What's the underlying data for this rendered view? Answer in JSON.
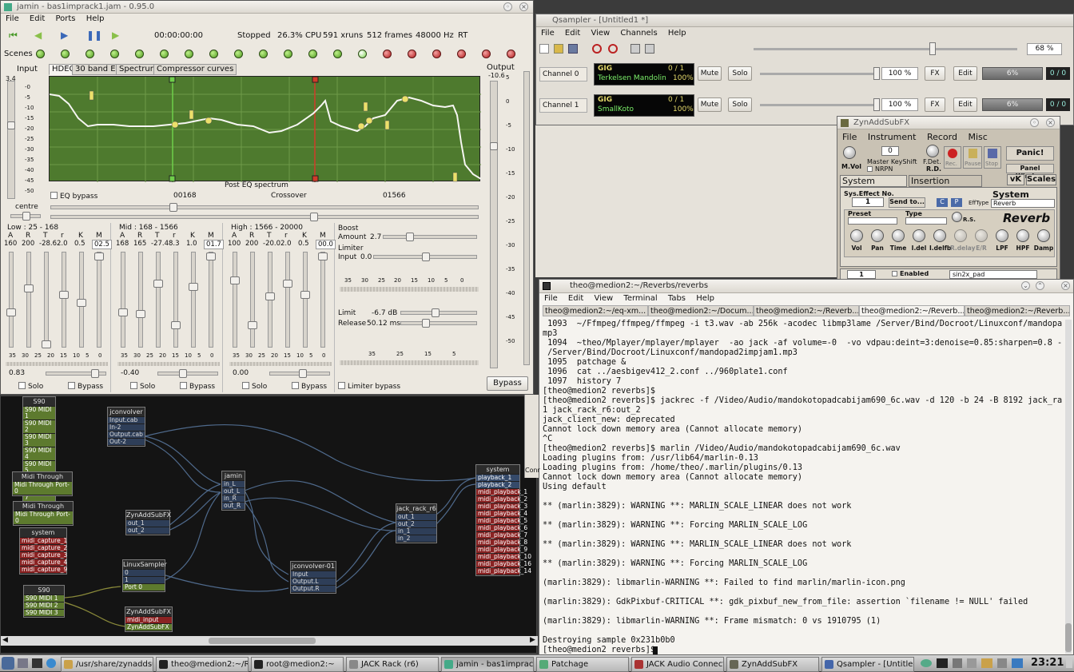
{
  "jamin": {
    "title": "jamin - bas1imprack1.jam - 0.95.0",
    "menu": [
      "File",
      "Edit",
      "Ports",
      "Help"
    ],
    "transport": {
      "time": "00:00:00:00",
      "status": "Stopped",
      "cpu": "26.3% CPU",
      "xruns": "591 xruns",
      "frames": "512 frames",
      "rate": "48000 Hz",
      "rt": "RT"
    },
    "scenes_label": "Scenes",
    "input_label": "Input",
    "input_value": "3.4",
    "input_ticks": [
      "-0",
      "-5",
      "-10",
      "-15",
      "-20",
      "-25",
      "-30",
      "-35",
      "-40",
      "-45",
      "-50"
    ],
    "output_label": "Output",
    "output_value": "-10.6",
    "output_ticks": [
      "5",
      "0",
      "-5",
      "-10",
      "-15",
      "-20",
      "-25",
      "-30",
      "-35",
      "-40",
      "-45",
      "-50"
    ],
    "centre_label": "centre",
    "tabs": [
      "HDEQ",
      "30 band EQ",
      "Spectrum",
      "Compressor curves"
    ],
    "eq_caption": "Post EQ spectrum",
    "eq_bypass": "EQ bypass",
    "xover_low": "00168",
    "crossover": "Crossover",
    "xover_high": "01566",
    "bands": [
      {
        "title": "Low : 25 - 168",
        "params": [
          "A",
          "R",
          "T",
          "r",
          "K",
          "M"
        ],
        "values": [
          "160",
          "200",
          "-28.6",
          "2.0",
          "0.5",
          "02.5"
        ],
        "gain": "0.83",
        "solo": "Solo",
        "bypass": "Bypass"
      },
      {
        "title": "Mid : 168 - 1566",
        "params": [
          "A",
          "R",
          "T",
          "r",
          "K",
          "M"
        ],
        "values": [
          "168",
          "165",
          "-27.4",
          "8.3",
          "1.0",
          "01.7"
        ],
        "gain": "-0.40",
        "solo": "Solo",
        "bypass": "Bypass"
      },
      {
        "title": "High : 1566 - 20000",
        "params": [
          "A",
          "R",
          "T",
          "r",
          "K",
          "M"
        ],
        "values": [
          "100",
          "200",
          "-20.0",
          "2.0",
          "0.5",
          "00.0"
        ],
        "gain": "0.00",
        "solo": "Solo",
        "bypass": "Bypass"
      }
    ],
    "meter_scale": [
      "35",
      "30",
      "25",
      "20",
      "15",
      "10",
      "5",
      "0"
    ],
    "boost": {
      "label": "Boost",
      "amount_label": "Amount",
      "amount": "2.7"
    },
    "limiter": {
      "label": "Limiter",
      "input_label": "Input",
      "input": "0.0",
      "limit_label": "Limit",
      "limit": "-6.7 dB",
      "release_label": "Release",
      "release": "50.12 ms",
      "bypass": "Limiter bypass"
    },
    "bypass_btn": "Bypass"
  },
  "patchbay": {
    "nodes": [
      {
        "name": "S90",
        "ports": [
          "S90 MIDI 1",
          "S90 MIDI 2",
          "S90 MIDI 3",
          "S90 MIDI 4",
          "S90 MIDI 5",
          "S90 MIDI 6",
          "S90 MIDI 7",
          "S90 MIDI 8"
        ]
      },
      {
        "name": "jconvolver",
        "ports": [
          "Input.cab",
          "In-2",
          "Output.cab",
          "Out-2"
        ]
      },
      {
        "name": "Midi Through",
        "ports": [
          "Midi Through Port-0"
        ]
      },
      {
        "name": "Midi Through",
        "ports": [
          "Midi Through Port-0"
        ]
      },
      {
        "name": "system",
        "ports": [
          "midi_capture_1",
          "midi_capture_2",
          "midi_capture_3",
          "midi_capture_4",
          "midi_capture_9"
        ]
      },
      {
        "name": "ZynAddSubFX",
        "ports": [
          "out_1",
          "out_2"
        ]
      },
      {
        "name": "jamin",
        "ports": [
          "in_L",
          "out_L",
          "in_R",
          "out_R"
        ]
      },
      {
        "name": "LinuxSampler",
        "ports": [
          "0",
          "1",
          "Port 0"
        ]
      },
      {
        "name": "jconvolver-01",
        "ports": [
          "Input",
          "Output.L",
          "Output.R"
        ]
      },
      {
        "name": "jack_rack_r6",
        "ports": [
          "out_1",
          "out_2",
          "in_1",
          "in_2"
        ]
      },
      {
        "name": "S90",
        "ports": [
          "S90 MIDI 1",
          "S90 MIDI 2",
          "S90 MIDI 3"
        ]
      },
      {
        "name": "ZynAddSubFX",
        "ports": [
          "midi_input",
          "ZynAddSubFX"
        ]
      },
      {
        "name": "system",
        "ports": [
          "playback_1",
          "playback_2",
          "midi_playback_1",
          "midi_playback_2",
          "midi_playback_3",
          "midi_playback_4",
          "midi_playback_5",
          "midi_playback_6",
          "midi_playback_7",
          "midi_playback_8",
          "midi_playback_9",
          "midi_playback_10",
          "midi_playback_16",
          "midi_playback_14"
        ]
      }
    ]
  },
  "qsampler": {
    "title": "Qsampler - [Untitled1 *]",
    "menu": [
      "File",
      "Edit",
      "View",
      "Channels",
      "Help"
    ],
    "zoom": "68 %",
    "channels": [
      {
        "label": "Channel 0",
        "engine": "GIG",
        "instrument": "Terkelsen Mandolin",
        "voices": "0 / 1",
        "volume_pct": "100%",
        "volume": "100 %",
        "mute": "Mute",
        "solo": "Solo",
        "fx": "FX",
        "edit": "Edit",
        "usage": "6%",
        "streams": "0 / 0"
      },
      {
        "label": "Channel 1",
        "engine": "GIG",
        "instrument": "SmallKoto",
        "voices": "0 / 1",
        "volume_pct": "100%",
        "volume": "100 %",
        "mute": "Mute",
        "solo": "Solo",
        "fx": "FX",
        "edit": "Edit",
        "usage": "6%",
        "streams": "0 / 0"
      }
    ]
  },
  "zyn": {
    "title": "ZynAddSubFX",
    "menu": [
      "File",
      "Instrument",
      "Record",
      "Misc"
    ],
    "labels": {
      "mvol": "M.Vol",
      "nrpn": "NRPN",
      "master_keyshift": "Master KeyShift",
      "keyshift": "0",
      "fdet": "F.Det.",
      "rd": "R.D.",
      "rec": "Rec.",
      "pause": "Pause",
      "stop": "Stop",
      "panic": "Panic!",
      "panel": "Panel Window",
      "vk": "vK",
      "scales": "Scales"
    },
    "tabs": [
      "System Effects",
      "Insertion Effects"
    ],
    "sys_no_label": "Sys.Effect No.",
    "sys_no": "1",
    "send": "Send to...",
    "c": "C",
    "p": "P",
    "efftype_label": "EffType",
    "efftype": "Reverb",
    "section": "System Effects",
    "preset_label": "Preset",
    "type_label": "Type",
    "rs": "R.S.",
    "effect_name": "Reverb",
    "knobs": [
      "Vol",
      "Pan",
      "Time",
      "I.del",
      "I.delfb",
      "R.delay",
      "E/R",
      "LPF",
      "HPF",
      "Damp"
    ],
    "bottom": {
      "num": "1",
      "enabled": "Enabled",
      "part": "sin2x_pad"
    }
  },
  "terminal": {
    "title": "theo@medion2:~/Reverbs/reverbs",
    "menu": [
      "File",
      "Edit",
      "View",
      "Terminal",
      "Tabs",
      "Help"
    ],
    "tabs": [
      "theo@medion2:~/eq-xm...",
      "theo@medion2:~/Docum...",
      "theo@medion2:~/Reverb...",
      "theo@medion2:~/Reverb...",
      "theo@medion2:~/Reverb..."
    ],
    "lines": [
      " 1093  ~/Ffmpeg/ffmpeg/ffmpeg -i t3.wav -ab 256k -acodec libmp3lame /Server/Bind/Docroot/Linuxconf/mandopad2impjam1.",
      "mp3",
      " 1094  ~theo/Mplayer/mplayer/mplayer  -ao jack -af volume=-0  -vo vdpau:deint=3:denoise=0.85:sharpen=0.8 -cache 8192",
      " /Server/Bind/Docroot/Linuxconf/mandopad2impjam1.mp3",
      " 1095  patchage &",
      " 1096  cat ../aesbigev412_2.conf ../960plate1.conf",
      " 1097  history 7",
      "[theo@medion2 reverbs]$",
      "[theo@medion2 reverbs]$ jackrec -f /Video/Audio/mandokotopadcabijam690_6c.wav -d 120 -b 24 -B 8192 jack_rack_r6:out_",
      "1 jack_rack_r6:out_2",
      "jack_client_new: deprecated",
      "Cannot lock down memory area (Cannot allocate memory)",
      "^C",
      "[theo@medion2 reverbs]$ marlin /Video/Audio/mandokotopadcabijam690_6c.wav",
      "Loading plugins from: /usr/lib64/marlin-0.13",
      "Loading plugins from: /home/theo/.marlin/plugins/0.13",
      "Cannot lock down memory area (Cannot allocate memory)",
      "Using default",
      "",
      "** (marlin:3829): WARNING **: MARLIN_SCALE_LINEAR does not work",
      "",
      "** (marlin:3829): WARNING **: Forcing MARLIN_SCALE_LOG",
      "",
      "** (marlin:3829): WARNING **: MARLIN_SCALE_LINEAR does not work",
      "",
      "** (marlin:3829): WARNING **: Forcing MARLIN_SCALE_LOG",
      "",
      "(marlin:3829): libmarlin-WARNING **: Failed to find marlin/marlin-icon.png",
      "",
      "(marlin:3829): GdkPixbuf-CRITICAL **: gdk_pixbuf_new_from_file: assertion `filename != NULL' failed",
      "",
      "(marlin:3829): libmarlin-WARNING **: Frame mismatch: 0 vs 1910795 (1)",
      "",
      "Destroying sample 0x231b0b0",
      "[theo@medion2 reverbs]$ "
    ]
  },
  "midstrip": {
    "label": "Conr"
  },
  "taskbar": {
    "items": [
      "/usr/share/zynaddsu",
      "theo@medion2:~/Re",
      "root@medion2:~",
      "JACK Rack (r6)",
      "jamin - bas1imprack",
      "Patchage",
      "JACK Audio Connecti",
      "ZynAddSubFX",
      "Qsampler - [Untitled"
    ],
    "clock": "23:21"
  }
}
